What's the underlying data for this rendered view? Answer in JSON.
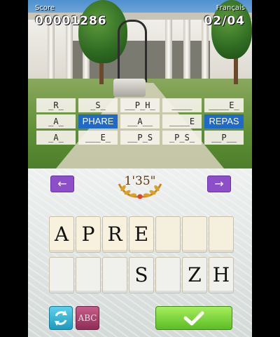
{
  "hud": {
    "score_label": "Score",
    "score_value": "00001286",
    "language_label": "Français",
    "progress_value": "02/04"
  },
  "grid": {
    "rows": [
      [
        "_R_",
        "_S_",
        "__P_H_",
        "____",
        "____E_"
      ],
      [
        "_A_",
        "PHARE",
        "__A__",
        "____E",
        "REPAS"
      ],
      [
        "_A_",
        "___E_",
        "__P_S",
        "_P_S_",
        "__P__"
      ]
    ],
    "highlighted": [
      "PHARE",
      "REPAS"
    ]
  },
  "controls": {
    "prev_icon": "left-arrow-icon",
    "next_icon": "right-arrow-icon",
    "prev_glyph": "←",
    "next_glyph": "→",
    "timer": "1'35\"",
    "shuffle_icon": "refresh-icon",
    "abc_label": "ABC",
    "confirm_icon": "checkmark-icon"
  },
  "answer_slots": [
    "A",
    "P",
    "R",
    "E",
    "",
    "",
    ""
  ],
  "letter_pool": [
    "",
    "",
    "",
    "S",
    "",
    "Z",
    "H"
  ],
  "colors": {
    "arrow_purple": "#8d4fc9",
    "highlight_blue": "#1f69c9",
    "confirm_green": "#5bbd24",
    "shuffle_cyan": "#1d9ac0",
    "abc_magenta": "#8e2d57"
  }
}
